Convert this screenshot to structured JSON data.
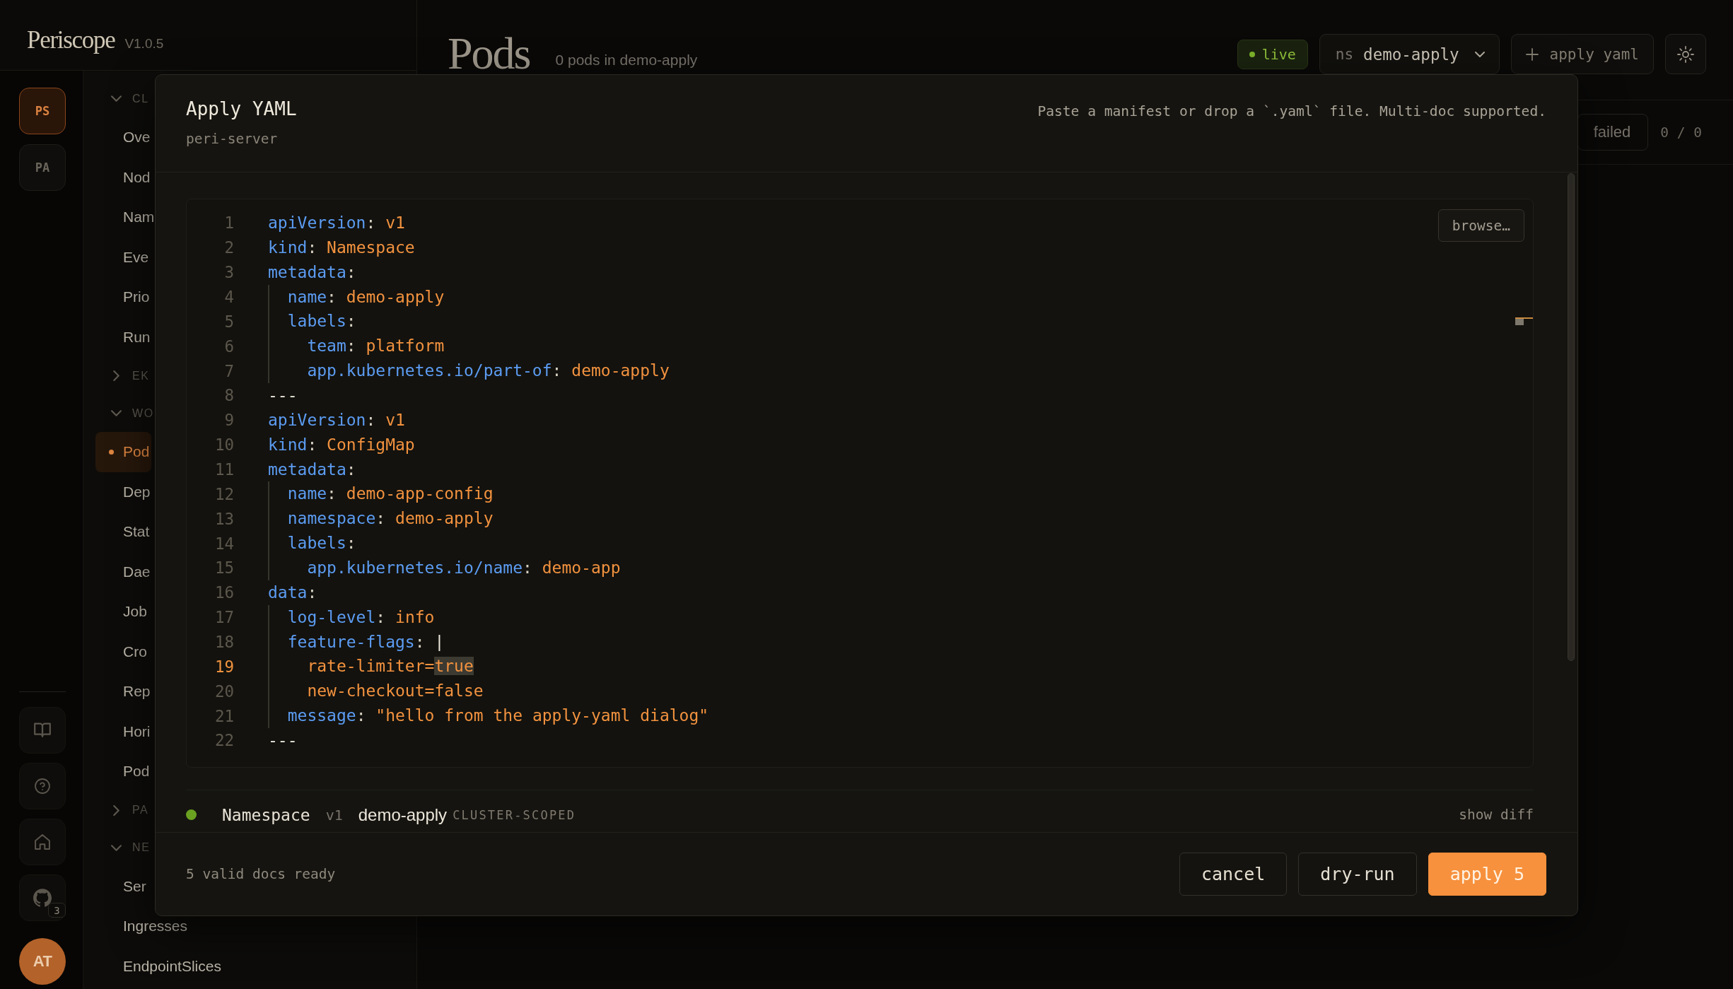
{
  "app": {
    "logo": "Periscope",
    "version": "V1.0.5"
  },
  "rail": {
    "clusters": [
      {
        "label": "PS",
        "selected": true
      },
      {
        "label": "PA",
        "selected": false
      }
    ],
    "tool_badge": "3",
    "avatar": "AT"
  },
  "nav": {
    "sections": [
      {
        "title": "CL",
        "expanded": true,
        "items": [
          {
            "label": "Ove",
            "selected": false
          },
          {
            "label": "Nod",
            "selected": false
          },
          {
            "label": "Nam",
            "selected": false
          },
          {
            "label": "Eve",
            "selected": false
          },
          {
            "label": "Prio",
            "selected": false
          },
          {
            "label": "Run",
            "selected": false
          }
        ]
      },
      {
        "title": "EK",
        "expanded": false
      },
      {
        "title": "WO",
        "expanded": true,
        "items": [
          {
            "label": "Pod",
            "selected": true
          },
          {
            "label": "Dep",
            "selected": false
          },
          {
            "label": "Stat",
            "selected": false
          },
          {
            "label": "Dae",
            "selected": false
          },
          {
            "label": "Job",
            "selected": false
          },
          {
            "label": "Cro",
            "selected": false
          },
          {
            "label": "Rep",
            "selected": false
          },
          {
            "label": "Hori",
            "selected": false
          },
          {
            "label": "Pod",
            "selected": false
          }
        ]
      },
      {
        "title": "PA",
        "expanded": false
      },
      {
        "title": "NE",
        "expanded": true,
        "items": [
          {
            "label": "Ser",
            "selected": false
          },
          {
            "label": "Ingresses",
            "selected": false
          },
          {
            "label": "EndpointSlices",
            "selected": false
          }
        ]
      }
    ]
  },
  "main": {
    "title": "Pods",
    "subtitle": "0 pods in demo-apply",
    "live": "live",
    "namespace": {
      "prefix": "ns",
      "value": "demo-apply"
    },
    "apply_button": "apply yaml",
    "filters": [
      {
        "label": "failed"
      }
    ],
    "count": "0 / 0"
  },
  "dialog": {
    "title": "Apply YAML",
    "subtitle": "peri-server",
    "hint": "Paste a manifest or drop a `.yaml` file. Multi-doc supported.",
    "browse_button": "browse…",
    "lines": [
      {
        "number": "1",
        "current": false,
        "tokens": [
          {
            "kind": "key",
            "text": "apiVersion"
          },
          {
            "kind": "punct",
            "text": ": "
          },
          {
            "kind": "value",
            "text": "v1"
          }
        ]
      },
      {
        "number": "2",
        "current": false,
        "tokens": [
          {
            "kind": "key",
            "text": "kind"
          },
          {
            "kind": "punct",
            "text": ": "
          },
          {
            "kind": "value",
            "text": "Namespace"
          }
        ]
      },
      {
        "number": "3",
        "current": false,
        "tokens": [
          {
            "kind": "key",
            "text": "metadata"
          },
          {
            "kind": "punct",
            "text": ":"
          }
        ]
      },
      {
        "number": "4",
        "current": false,
        "tokens": [
          {
            "kind": "key",
            "text": "  name"
          },
          {
            "kind": "punct",
            "text": ": "
          },
          {
            "kind": "value",
            "text": "demo-apply"
          }
        ]
      },
      {
        "number": "5",
        "current": false,
        "tokens": [
          {
            "kind": "key",
            "text": "  labels"
          },
          {
            "kind": "punct",
            "text": ":"
          }
        ]
      },
      {
        "number": "6",
        "current": false,
        "tokens": [
          {
            "kind": "key",
            "text": "    team"
          },
          {
            "kind": "punct",
            "text": ": "
          },
          {
            "kind": "value",
            "text": "platform"
          }
        ]
      },
      {
        "number": "7",
        "current": false,
        "tokens": [
          {
            "kind": "key",
            "text": "    app.kubernetes.io/part-of"
          },
          {
            "kind": "punct",
            "text": ": "
          },
          {
            "kind": "value",
            "text": "demo-apply"
          }
        ]
      },
      {
        "number": "8",
        "current": false,
        "tokens": [
          {
            "kind": "plain",
            "text": "---"
          }
        ]
      },
      {
        "number": "9",
        "current": false,
        "tokens": [
          {
            "kind": "key",
            "text": "apiVersion"
          },
          {
            "kind": "punct",
            "text": ": "
          },
          {
            "kind": "value",
            "text": "v1"
          }
        ]
      },
      {
        "number": "10",
        "current": false,
        "tokens": [
          {
            "kind": "key",
            "text": "kind"
          },
          {
            "kind": "punct",
            "text": ": "
          },
          {
            "kind": "value",
            "text": "ConfigMap"
          }
        ]
      },
      {
        "number": "11",
        "current": false,
        "tokens": [
          {
            "kind": "key",
            "text": "metadata"
          },
          {
            "kind": "punct",
            "text": ":"
          }
        ]
      },
      {
        "number": "12",
        "current": false,
        "tokens": [
          {
            "kind": "key",
            "text": "  name"
          },
          {
            "kind": "punct",
            "text": ": "
          },
          {
            "kind": "value",
            "text": "demo-app-config"
          }
        ]
      },
      {
        "number": "13",
        "current": false,
        "tokens": [
          {
            "kind": "key",
            "text": "  namespace"
          },
          {
            "kind": "punct",
            "text": ": "
          },
          {
            "kind": "value",
            "text": "demo-apply"
          }
        ]
      },
      {
        "number": "14",
        "current": false,
        "tokens": [
          {
            "kind": "key",
            "text": "  labels"
          },
          {
            "kind": "punct",
            "text": ":"
          }
        ]
      },
      {
        "number": "15",
        "current": false,
        "tokens": [
          {
            "kind": "key",
            "text": "    app.kubernetes.io/name"
          },
          {
            "kind": "punct",
            "text": ": "
          },
          {
            "kind": "value",
            "text": "demo-app"
          }
        ]
      },
      {
        "number": "16",
        "current": false,
        "tokens": [
          {
            "kind": "key",
            "text": "data"
          },
          {
            "kind": "punct",
            "text": ":"
          }
        ]
      },
      {
        "number": "17",
        "current": false,
        "tokens": [
          {
            "kind": "key",
            "text": "  log-level"
          },
          {
            "kind": "punct",
            "text": ": "
          },
          {
            "kind": "value",
            "text": "info"
          }
        ]
      },
      {
        "number": "18",
        "current": false,
        "tokens": [
          {
            "kind": "key",
            "text": "  feature-flags"
          },
          {
            "kind": "punct",
            "text": ": "
          },
          {
            "kind": "plain",
            "text": "|"
          }
        ]
      },
      {
        "number": "19",
        "current": true,
        "tokens": [
          {
            "kind": "value",
            "text": "    rate-limiter="
          },
          {
            "kind": "match",
            "text": "true"
          }
        ]
      },
      {
        "number": "20",
        "current": false,
        "tokens": [
          {
            "kind": "value",
            "text": "    new-checkout=false"
          }
        ]
      },
      {
        "number": "21",
        "current": false,
        "tokens": [
          {
            "kind": "key",
            "text": "  message"
          },
          {
            "kind": "punct",
            "text": ": "
          },
          {
            "kind": "value",
            "text": "\"hello from the apply-yaml dialog\""
          }
        ]
      },
      {
        "number": "22",
        "current": false,
        "tokens": [
          {
            "kind": "plain",
            "text": "---"
          }
        ]
      }
    ],
    "docs": [
      {
        "color": "#6aa121",
        "kind": "Namespace",
        "version": "v1",
        "name": "demo-apply",
        "scope": "CLUSTER-SCOPED",
        "action": "show diff"
      }
    ],
    "status": "5 valid docs ready",
    "buttons": [
      {
        "label": "cancel",
        "kind": "secondary"
      },
      {
        "label": "dry-run",
        "kind": "secondary"
      },
      {
        "label": "apply 5",
        "kind": "primary"
      }
    ]
  }
}
